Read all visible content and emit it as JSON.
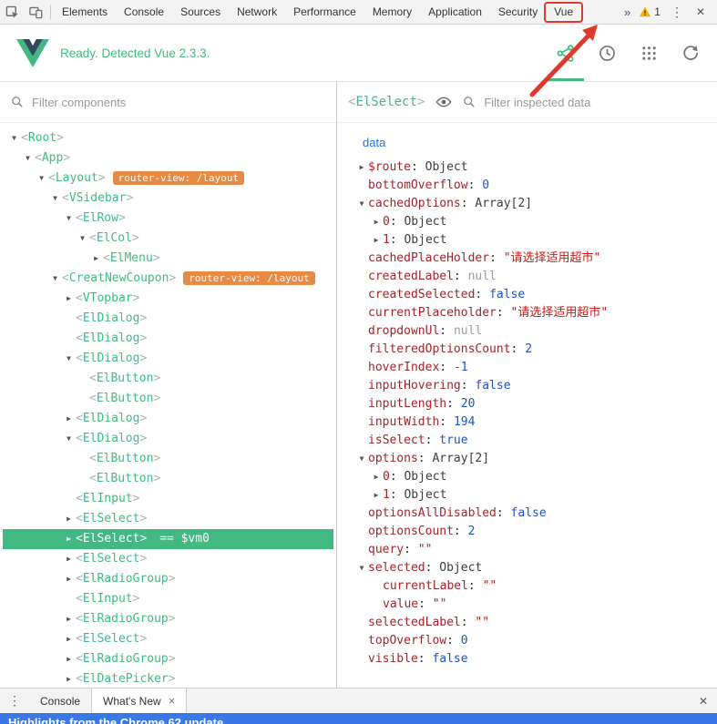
{
  "punctuation": {
    "lt": "<",
    "gt": ">",
    "colon": ":"
  },
  "icons": {
    "arrow_down": "▼",
    "arrow_right": "▶",
    "more_vertical": "⋮",
    "close": "✕",
    "close_small": "×",
    "overflow": "»"
  },
  "colors": {
    "accent_green": "#42b983",
    "logo_dark": "#35495e",
    "selected_bg": "#42b983",
    "badge_orange": "#e78a45",
    "bracket_gray": "#a6b5ad",
    "annotation_red": "#e2382c",
    "key_maroon": "#a0262c",
    "string_red": "#c41a16",
    "number_blue": "#1d53c9",
    "null_gray": "#9aa0a6",
    "object_dark": "#3c3c3c",
    "section_blue": "#1a73e8",
    "whats_new_blue": "#3b78e7",
    "warning_yellow": "#f2b400"
  },
  "devtools_tabs": {
    "tabs": [
      "Elements",
      "Console",
      "Sources",
      "Network",
      "Performance",
      "Memory",
      "Application",
      "Security",
      "Vue"
    ],
    "highlighted_tab": "Vue",
    "warning_count": "1"
  },
  "vue_header": {
    "status": "Ready. Detected Vue 2.3.3."
  },
  "left_panel": {
    "filter_placeholder": "Filter components",
    "tree": [
      {
        "indent": 0,
        "arrow": "down",
        "tag": "Root"
      },
      {
        "indent": 1,
        "arrow": "down",
        "tag": "App"
      },
      {
        "indent": 2,
        "arrow": "down",
        "tag": "Layout",
        "badge": "router-view: /layout"
      },
      {
        "indent": 3,
        "arrow": "down",
        "tag": "VSidebar"
      },
      {
        "indent": 4,
        "arrow": "down",
        "tag": "ElRow"
      },
      {
        "indent": 5,
        "arrow": "down",
        "tag": "ElCol"
      },
      {
        "indent": 6,
        "arrow": "right",
        "tag": "ElMenu"
      },
      {
        "indent": 3,
        "arrow": "down",
        "tag": "CreatNewCoupon",
        "badge": "router-view: /layout"
      },
      {
        "indent": 4,
        "arrow": "right",
        "tag": "VTopbar"
      },
      {
        "indent": 4,
        "arrow": "none",
        "tag": "ElDialog"
      },
      {
        "indent": 4,
        "arrow": "none",
        "tag": "ElDialog"
      },
      {
        "indent": 4,
        "arrow": "down",
        "tag": "ElDialog"
      },
      {
        "indent": 5,
        "arrow": "none",
        "tag": "ElButton"
      },
      {
        "indent": 5,
        "arrow": "none",
        "tag": "ElButton"
      },
      {
        "indent": 4,
        "arrow": "right",
        "tag": "ElDialog"
      },
      {
        "indent": 4,
        "arrow": "down",
        "tag": "ElDialog"
      },
      {
        "indent": 5,
        "arrow": "none",
        "tag": "ElButton"
      },
      {
        "indent": 5,
        "arrow": "none",
        "tag": "ElButton"
      },
      {
        "indent": 4,
        "arrow": "none",
        "tag": "ElInput"
      },
      {
        "indent": 4,
        "arrow": "right",
        "tag": "ElSelect"
      },
      {
        "indent": 4,
        "arrow": "right",
        "tag": "ElSelect",
        "selected": true,
        "suffix": "== $vm0"
      },
      {
        "indent": 4,
        "arrow": "right",
        "tag": "ElSelect"
      },
      {
        "indent": 4,
        "arrow": "right",
        "tag": "ElRadioGroup"
      },
      {
        "indent": 4,
        "arrow": "none",
        "tag": "ElInput"
      },
      {
        "indent": 4,
        "arrow": "right",
        "tag": "ElRadioGroup"
      },
      {
        "indent": 4,
        "arrow": "right",
        "tag": "ElSelect"
      },
      {
        "indent": 4,
        "arrow": "right",
        "tag": "ElRadioGroup"
      },
      {
        "indent": 4,
        "arrow": "right",
        "tag": "ElDatePicker"
      }
    ]
  },
  "right_panel": {
    "selected_tag": "ElSelect",
    "filter_placeholder": "Filter inspected data",
    "section": "data",
    "fields": [
      {
        "indent": 0,
        "arrow": "right",
        "key": "$route",
        "value": "Object",
        "type": "object"
      },
      {
        "indent": 0,
        "arrow": "none",
        "key": "bottomOverflow",
        "value": "0",
        "type": "number"
      },
      {
        "indent": 0,
        "arrow": "down",
        "key": "cachedOptions",
        "value": "Array[2]",
        "type": "object"
      },
      {
        "indent": 1,
        "arrow": "right",
        "key": "0",
        "value": "Object",
        "type": "object"
      },
      {
        "indent": 1,
        "arrow": "right",
        "key": "1",
        "value": "Object",
        "type": "object"
      },
      {
        "indent": 0,
        "arrow": "none",
        "key": "cachedPlaceHolder",
        "value": "\"请选择适用超市\"",
        "type": "string"
      },
      {
        "indent": 0,
        "arrow": "none",
        "key": "createdLabel",
        "value": "null",
        "type": "null"
      },
      {
        "indent": 0,
        "arrow": "none",
        "key": "createdSelected",
        "value": "false",
        "type": "boolean"
      },
      {
        "indent": 0,
        "arrow": "none",
        "key": "currentPlaceholder",
        "value": "\"请选择适用超市\"",
        "type": "string"
      },
      {
        "indent": 0,
        "arrow": "none",
        "key": "dropdownUl",
        "value": "null",
        "type": "null"
      },
      {
        "indent": 0,
        "arrow": "none",
        "key": "filteredOptionsCount",
        "value": "2",
        "type": "number"
      },
      {
        "indent": 0,
        "arrow": "none",
        "key": "hoverIndex",
        "value": "-1",
        "type": "number"
      },
      {
        "indent": 0,
        "arrow": "none",
        "key": "inputHovering",
        "value": "false",
        "type": "boolean"
      },
      {
        "indent": 0,
        "arrow": "none",
        "key": "inputLength",
        "value": "20",
        "type": "number"
      },
      {
        "indent": 0,
        "arrow": "none",
        "key": "inputWidth",
        "value": "194",
        "type": "number"
      },
      {
        "indent": 0,
        "arrow": "none",
        "key": "isSelect",
        "value": "true",
        "type": "boolean"
      },
      {
        "indent": 0,
        "arrow": "down",
        "key": "options",
        "value": "Array[2]",
        "type": "object"
      },
      {
        "indent": 1,
        "arrow": "right",
        "key": "0",
        "value": "Object",
        "type": "object"
      },
      {
        "indent": 1,
        "arrow": "right",
        "key": "1",
        "value": "Object",
        "type": "object"
      },
      {
        "indent": 0,
        "arrow": "none",
        "key": "optionsAllDisabled",
        "value": "false",
        "type": "boolean"
      },
      {
        "indent": 0,
        "arrow": "none",
        "key": "optionsCount",
        "value": "2",
        "type": "number"
      },
      {
        "indent": 0,
        "arrow": "none",
        "key": "query",
        "value": "\"\"",
        "type": "string"
      },
      {
        "indent": 0,
        "arrow": "down",
        "key": "selected",
        "value": "Object",
        "type": "object"
      },
      {
        "indent": 1,
        "arrow": "none",
        "key": "currentLabel",
        "value": "\"\"",
        "type": "string"
      },
      {
        "indent": 1,
        "arrow": "none",
        "key": "value",
        "value": "\"\"",
        "type": "string"
      },
      {
        "indent": 0,
        "arrow": "none",
        "key": "selectedLabel",
        "value": "\"\"",
        "type": "string"
      },
      {
        "indent": 0,
        "arrow": "none",
        "key": "topOverflow",
        "value": "0",
        "type": "number"
      },
      {
        "indent": 0,
        "arrow": "none",
        "key": "visible",
        "value": "false",
        "type": "boolean"
      }
    ]
  },
  "console_drawer": {
    "tabs": [
      "Console",
      "What's New"
    ],
    "active_tab": "What's New"
  },
  "whats_new": {
    "title": "Highlights from the Chrome 62 update"
  }
}
